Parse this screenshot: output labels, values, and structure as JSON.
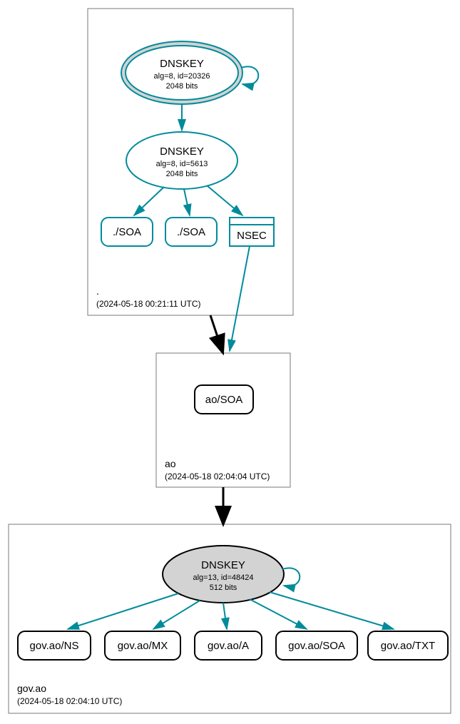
{
  "zones": {
    "root": {
      "name": ".",
      "timestamp": "(2024-05-18 00:21:11 UTC)"
    },
    "ao": {
      "name": "ao",
      "timestamp": "(2024-05-18 02:04:04 UTC)"
    },
    "govao": {
      "name": "gov.ao",
      "timestamp": "(2024-05-18 02:04:10 UTC)"
    }
  },
  "nodes": {
    "root_ksk": {
      "title": "DNSKEY",
      "line2": "alg=8, id=20326",
      "line3": "2048 bits"
    },
    "root_zsk": {
      "title": "DNSKEY",
      "line2": "alg=8, id=5613",
      "line3": "2048 bits"
    },
    "root_soa1": "./SOA",
    "root_soa2": "./SOA",
    "root_nsec": "NSEC",
    "ao_soa": "ao/SOA",
    "govao_key": {
      "title": "DNSKEY",
      "line2": "alg=13, id=48424",
      "line3": "512 bits"
    },
    "govao_ns": "gov.ao/NS",
    "govao_mx": "gov.ao/MX",
    "govao_a": "gov.ao/A",
    "govao_soa": "gov.ao/SOA",
    "govao_txt": "gov.ao/TXT"
  }
}
